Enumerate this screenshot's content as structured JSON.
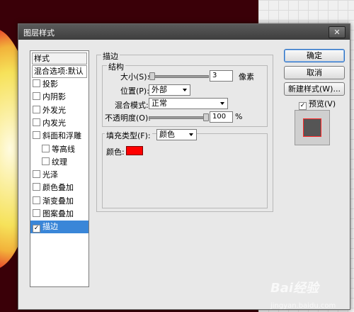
{
  "dialog": {
    "title": "图层样式",
    "close_icon": "close-icon"
  },
  "left": {
    "header": "样式",
    "blend_default": "混合选项:默认",
    "items": [
      {
        "label": "投影",
        "checked": false
      },
      {
        "label": "内阴影",
        "checked": false
      },
      {
        "label": "外发光",
        "checked": false
      },
      {
        "label": "内发光",
        "checked": false
      },
      {
        "label": "斜面和浮雕",
        "checked": false
      },
      {
        "label": "等高线",
        "checked": false
      },
      {
        "label": "纹理",
        "checked": false
      },
      {
        "label": "光泽",
        "checked": false
      },
      {
        "label": "颜色叠加",
        "checked": false
      },
      {
        "label": "渐变叠加",
        "checked": false
      },
      {
        "label": "图案叠加",
        "checked": false
      },
      {
        "label": "描边",
        "checked": true
      }
    ]
  },
  "stroke": {
    "group_title": "描边",
    "structure_title": "结构",
    "size_label": "大小(S):",
    "size_value": "3",
    "size_unit": "像素",
    "position_label": "位置(P):",
    "position_value": "外部",
    "blend_label": "混合模式:",
    "blend_value": "正常",
    "opacity_label": "不透明度(O):",
    "opacity_value": "100",
    "opacity_unit": "%",
    "fill_type_label": "填充类型(F):",
    "fill_type_value": "颜色",
    "color_label": "颜色:",
    "color": "#ff0000"
  },
  "buttons": {
    "ok": "确定",
    "cancel": "取消",
    "new_style": "新建样式(W)...",
    "preview": "预览(V)",
    "preview_checked": true
  },
  "watermark": {
    "text": "Bai经验",
    "sub": "jingyan.baidu.com"
  }
}
